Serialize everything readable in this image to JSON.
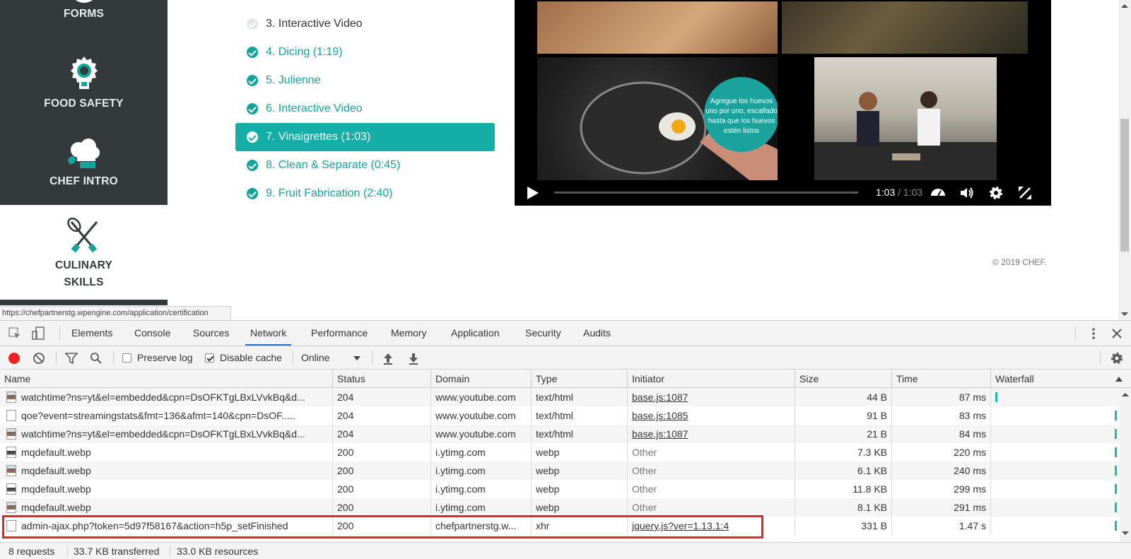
{
  "page": {
    "sidebar": {
      "items": [
        {
          "label": "FORMS",
          "icon": "forms-icon"
        },
        {
          "label": "FOOD SAFETY",
          "icon": "food-safety-badge-icon"
        },
        {
          "label": "CHEF INTRO",
          "icon": "chef-hat-icon"
        }
      ],
      "culinary": {
        "line1": "CULINARY",
        "line2": "SKILLS",
        "icon": "whisk-knife-icon"
      }
    },
    "lessons": [
      {
        "label": "3. Interactive Video",
        "state": "pending"
      },
      {
        "label": "4. Dicing (1:19)",
        "state": "done"
      },
      {
        "label": "5. Julienne",
        "state": "done"
      },
      {
        "label": "6. Interactive Video",
        "state": "done"
      },
      {
        "label": "7. Vinaigrettes (1:03)",
        "state": "active"
      },
      {
        "label": "8. Clean & Separate (0:45)",
        "state": "done"
      },
      {
        "label": "9. Fruit Fabrication (2:40)",
        "state": "done"
      }
    ],
    "video": {
      "overlay_line1": "Agregue los huevos",
      "overlay_line2": "uno por uno, escalfado",
      "overlay_line3": "hasta que los huevos",
      "overlay_line4": "estén listos",
      "time_current": "1:03",
      "time_total": "/ 1:03",
      "progress": 1.0
    },
    "copyright": "© 2019 CHEF.",
    "status_url": "https://chefpartnerstg.wpengine.com/application/certification"
  },
  "devtools": {
    "tabs": [
      "Elements",
      "Console",
      "Sources",
      "Network",
      "Performance",
      "Memory",
      "Application",
      "Security",
      "Audits"
    ],
    "active_tab": "Network",
    "toolbar": {
      "preserve_log": "Preserve log",
      "disable_cache": "Disable cache",
      "throttle": "Online",
      "preserve_log_checked": false,
      "disable_cache_checked": true
    },
    "columns": [
      "Name",
      "Status",
      "Domain",
      "Type",
      "Initiator",
      "Size",
      "Time",
      "Waterfall"
    ],
    "rows": [
      {
        "name": "watchtime?ns=yt&el=embedded&cpn=DsOFKTgLBxLVvkBq&d...",
        "status": "204",
        "domain": "www.youtube.com",
        "type": "text/html",
        "initiator": "base.js:1087",
        "initiator_link": true,
        "size": "44 B",
        "time": "87 ms",
        "icon": "image-file-icon"
      },
      {
        "name": "qoe?event=streamingstats&fmt=136&afmt=140&cpn=DsOF.....",
        "status": "204",
        "domain": "www.youtube.com",
        "type": "text/html",
        "initiator": "base.js:1085",
        "initiator_link": true,
        "size": "91 B",
        "time": "83 ms",
        "icon": "document-file-icon"
      },
      {
        "name": "watchtime?ns=yt&el=embedded&cpn=DsOFKTgLBxLVvkBq&d...",
        "status": "204",
        "domain": "www.youtube.com",
        "type": "text/html",
        "initiator": "base.js:1087",
        "initiator_link": true,
        "size": "21 B",
        "time": "84 ms",
        "icon": "image-file-icon"
      },
      {
        "name": "mqdefault.webp",
        "status": "200",
        "domain": "i.ytimg.com",
        "type": "webp",
        "initiator": "Other",
        "initiator_link": false,
        "size": "7.3 KB",
        "time": "220 ms",
        "icon": "image-file-icon"
      },
      {
        "name": "mqdefault.webp",
        "status": "200",
        "domain": "i.ytimg.com",
        "type": "webp",
        "initiator": "Other",
        "initiator_link": false,
        "size": "6.1 KB",
        "time": "240 ms",
        "icon": "image-file-icon"
      },
      {
        "name": "mqdefault.webp",
        "status": "200",
        "domain": "i.ytimg.com",
        "type": "webp",
        "initiator": "Other",
        "initiator_link": false,
        "size": "11.8 KB",
        "time": "299 ms",
        "icon": "image-file-icon"
      },
      {
        "name": "mqdefault.webp",
        "status": "200",
        "domain": "i.ytimg.com",
        "type": "webp",
        "initiator": "Other",
        "initiator_link": false,
        "size": "8.1 KB",
        "time": "291 ms",
        "icon": "image-file-icon"
      },
      {
        "name": "admin-ajax.php?token=5d97f58167&action=h5p_setFinished",
        "status": "200",
        "domain": "chefpartnerstg.w...",
        "type": "xhr",
        "initiator": "jquery.js?ver=1.13.1:4",
        "initiator_link": true,
        "size": "331 B",
        "time": "1.47 s",
        "icon": "document-file-icon",
        "highlighted": true
      }
    ],
    "status_bar": {
      "requests": "8 requests",
      "transferred": "33.7 KB transferred",
      "resources": "33.0 KB resources"
    }
  },
  "colors": {
    "accent": "#12a59c",
    "sidebar_bg": "#343a3c",
    "highlight_border": "#e0262b",
    "devtools_active": "#1a73e8"
  }
}
